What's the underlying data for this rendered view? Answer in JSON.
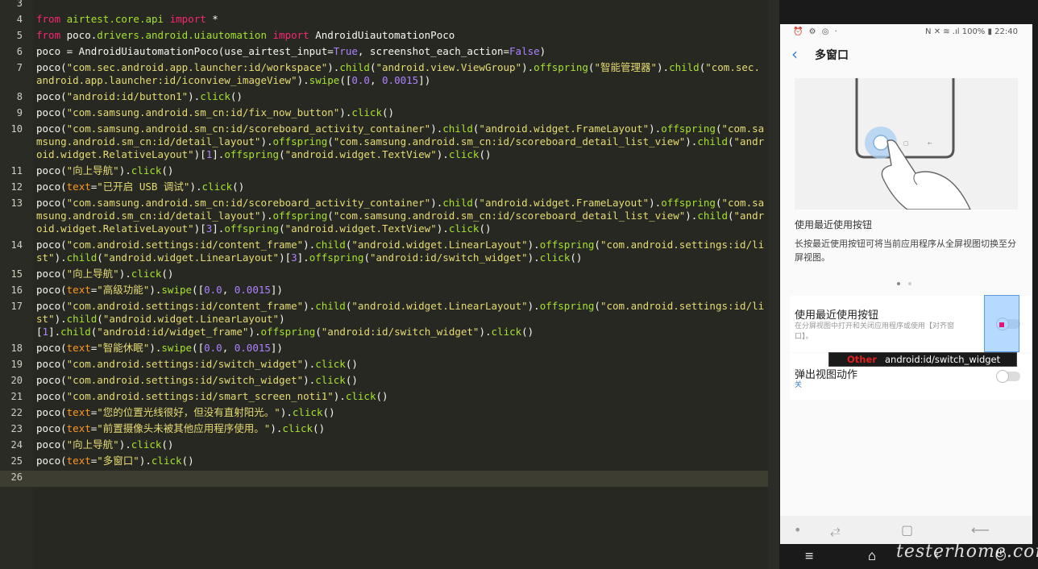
{
  "editor": {
    "lines": [
      {
        "num": "3",
        "rows": 1,
        "tokens": []
      },
      {
        "num": "4",
        "rows": 1,
        "tokens": [
          [
            "kw",
            "from"
          ],
          [
            "plain",
            " "
          ],
          [
            "mod",
            "airtest.core.api"
          ],
          [
            "plain",
            " "
          ],
          [
            "kw",
            "import"
          ],
          [
            "plain",
            " *"
          ]
        ]
      },
      {
        "num": "5",
        "rows": 1,
        "tokens": [
          [
            "kw",
            "from"
          ],
          [
            "plain",
            " poco."
          ],
          [
            "mod",
            "drivers.android.uiautomation"
          ],
          [
            "plain",
            " "
          ],
          [
            "kw",
            "import"
          ],
          [
            "plain",
            " AndroidUiautomationPoco"
          ]
        ]
      },
      {
        "num": "6",
        "rows": 1,
        "tokens": [
          [
            "plain",
            "poco = AndroidUiautomationPoco(use_airtest_input="
          ],
          [
            "const",
            "True"
          ],
          [
            "plain",
            ", screenshot_each_action="
          ],
          [
            "const",
            "False"
          ],
          [
            "plain",
            ")"
          ]
        ]
      },
      {
        "num": "7",
        "rows": 2,
        "tokens": [
          [
            "plain",
            "poco("
          ],
          [
            "str",
            "\"com.sec.android.app.launcher:id/workspace\""
          ],
          [
            "plain",
            ")."
          ],
          [
            "fn",
            "child"
          ],
          [
            "plain",
            "("
          ],
          [
            "str",
            "\"android.view.ViewGroup\""
          ],
          [
            "plain",
            ")."
          ],
          [
            "fn",
            "offspring"
          ],
          [
            "plain",
            "("
          ],
          [
            "str",
            "\"智能管理器\""
          ],
          [
            "plain",
            ")."
          ],
          [
            "fn",
            "child"
          ],
          [
            "plain",
            "("
          ],
          [
            "str",
            "\"com.sec.android.app.launcher:id/iconview_imageView\""
          ],
          [
            "plain",
            ")."
          ],
          [
            "fn",
            "swipe"
          ],
          [
            "plain",
            "(["
          ],
          [
            "num",
            "0.0"
          ],
          [
            "plain",
            ", "
          ],
          [
            "num",
            "0.0015"
          ],
          [
            "plain",
            "])"
          ]
        ]
      },
      {
        "num": "8",
        "rows": 1,
        "tokens": [
          [
            "plain",
            "poco("
          ],
          [
            "str",
            "\"android:id/button1\""
          ],
          [
            "plain",
            ")."
          ],
          [
            "fn",
            "click"
          ],
          [
            "plain",
            "()"
          ]
        ]
      },
      {
        "num": "9",
        "rows": 1,
        "tokens": [
          [
            "plain",
            "poco("
          ],
          [
            "str",
            "\"com.samsung.android.sm_cn:id/fix_now_button\""
          ],
          [
            "plain",
            ")."
          ],
          [
            "fn",
            "click"
          ],
          [
            "plain",
            "()"
          ]
        ]
      },
      {
        "num": "10",
        "rows": 3,
        "tokens": [
          [
            "plain",
            "poco("
          ],
          [
            "str",
            "\"com.samsung.android.sm_cn:id/scoreboard_activity_container\""
          ],
          [
            "plain",
            ")."
          ],
          [
            "fn",
            "child"
          ],
          [
            "plain",
            "("
          ],
          [
            "str",
            "\"android.widget.FrameLayout\""
          ],
          [
            "plain",
            ")."
          ],
          [
            "fn",
            "offspring"
          ],
          [
            "plain",
            "("
          ],
          [
            "str",
            "\"com.samsung.android.sm_cn:id/detail_layout\""
          ],
          [
            "plain",
            ")."
          ],
          [
            "fn",
            "offspring"
          ],
          [
            "plain",
            "("
          ],
          [
            "str",
            "\"com.samsung.android.sm_cn:id/scoreboard_detail_list_view\""
          ],
          [
            "plain",
            ")."
          ],
          [
            "fn",
            "child"
          ],
          [
            "plain",
            "("
          ],
          [
            "str",
            "\"android.widget.RelativeLayout\""
          ],
          [
            "plain",
            ")["
          ],
          [
            "num",
            "1"
          ],
          [
            "plain",
            "]."
          ],
          [
            "fn",
            "offspring"
          ],
          [
            "plain",
            "("
          ],
          [
            "str",
            "\"android.widget.TextView\""
          ],
          [
            "plain",
            ")."
          ],
          [
            "fn",
            "click"
          ],
          [
            "plain",
            "()"
          ]
        ]
      },
      {
        "num": "11",
        "rows": 1,
        "tokens": [
          [
            "plain",
            "poco("
          ],
          [
            "str",
            "\"向上导航\""
          ],
          [
            "plain",
            ")."
          ],
          [
            "fn",
            "click"
          ],
          [
            "plain",
            "()"
          ]
        ]
      },
      {
        "num": "12",
        "rows": 1,
        "tokens": [
          [
            "plain",
            "poco("
          ],
          [
            "param",
            "text"
          ],
          [
            "plain",
            "="
          ],
          [
            "str",
            "\"已开启 USB 调试\""
          ],
          [
            "plain",
            ")."
          ],
          [
            "fn",
            "click"
          ],
          [
            "plain",
            "()"
          ]
        ]
      },
      {
        "num": "13",
        "rows": 3,
        "tokens": [
          [
            "plain",
            "poco("
          ],
          [
            "str",
            "\"com.samsung.android.sm_cn:id/scoreboard_activity_container\""
          ],
          [
            "plain",
            ")."
          ],
          [
            "fn",
            "child"
          ],
          [
            "plain",
            "("
          ],
          [
            "str",
            "\"android.widget.FrameLayout\""
          ],
          [
            "plain",
            ")."
          ],
          [
            "fn",
            "offspring"
          ],
          [
            "plain",
            "("
          ],
          [
            "str",
            "\"com.samsung.android.sm_cn:id/detail_layout\""
          ],
          [
            "plain",
            ")."
          ],
          [
            "fn",
            "offspring"
          ],
          [
            "plain",
            "("
          ],
          [
            "str",
            "\"com.samsung.android.sm_cn:id/scoreboard_detail_list_view\""
          ],
          [
            "plain",
            ")."
          ],
          [
            "fn",
            "child"
          ],
          [
            "plain",
            "("
          ],
          [
            "str",
            "\"android.widget.RelativeLayout\""
          ],
          [
            "plain",
            ")["
          ],
          [
            "num",
            "3"
          ],
          [
            "plain",
            "]."
          ],
          [
            "fn",
            "offspring"
          ],
          [
            "plain",
            "("
          ],
          [
            "str",
            "\"android.widget.TextView\""
          ],
          [
            "plain",
            ")."
          ],
          [
            "fn",
            "click"
          ],
          [
            "plain",
            "()"
          ]
        ]
      },
      {
        "num": "14",
        "rows": 2,
        "tokens": [
          [
            "plain",
            "poco("
          ],
          [
            "str",
            "\"com.android.settings:id/content_frame\""
          ],
          [
            "plain",
            ")."
          ],
          [
            "fn",
            "child"
          ],
          [
            "plain",
            "("
          ],
          [
            "str",
            "\"android.widget.LinearLayout\""
          ],
          [
            "plain",
            ")."
          ],
          [
            "fn",
            "offspring"
          ],
          [
            "plain",
            "("
          ],
          [
            "str",
            "\"com.android.settings:id/list\""
          ],
          [
            "plain",
            ")."
          ],
          [
            "fn",
            "child"
          ],
          [
            "plain",
            "("
          ],
          [
            "str",
            "\"android.widget.LinearLayout\""
          ],
          [
            "plain",
            ")["
          ],
          [
            "num",
            "3"
          ],
          [
            "plain",
            "]."
          ],
          [
            "fn",
            "offspring"
          ],
          [
            "plain",
            "("
          ],
          [
            "str",
            "\"android:id/switch_widget\""
          ],
          [
            "plain",
            ")."
          ],
          [
            "fn",
            "click"
          ],
          [
            "plain",
            "()"
          ]
        ]
      },
      {
        "num": "15",
        "rows": 1,
        "tokens": [
          [
            "plain",
            "poco("
          ],
          [
            "str",
            "\"向上导航\""
          ],
          [
            "plain",
            ")."
          ],
          [
            "fn",
            "click"
          ],
          [
            "plain",
            "()"
          ]
        ]
      },
      {
        "num": "16",
        "rows": 1,
        "tokens": [
          [
            "plain",
            "poco("
          ],
          [
            "param",
            "text"
          ],
          [
            "plain",
            "="
          ],
          [
            "str",
            "\"高级功能\""
          ],
          [
            "plain",
            ")."
          ],
          [
            "fn",
            "swipe"
          ],
          [
            "plain",
            "(["
          ],
          [
            "num",
            "0.0"
          ],
          [
            "plain",
            ", "
          ],
          [
            "num",
            "0.0015"
          ],
          [
            "plain",
            "])"
          ]
        ]
      },
      {
        "num": "17",
        "rows": 3,
        "tokens": [
          [
            "plain",
            "poco("
          ],
          [
            "str",
            "\"com.android.settings:id/content_frame\""
          ],
          [
            "plain",
            ")."
          ],
          [
            "fn",
            "child"
          ],
          [
            "plain",
            "("
          ],
          [
            "str",
            "\"android.widget.LinearLayout\""
          ],
          [
            "plain",
            ")."
          ],
          [
            "fn",
            "offspring"
          ],
          [
            "plain",
            "("
          ],
          [
            "str",
            "\"com.android.settings:id/list\""
          ],
          [
            "plain",
            ")."
          ],
          [
            "fn",
            "child"
          ],
          [
            "plain",
            "("
          ],
          [
            "str",
            "\"android.widget.LinearLayout\""
          ],
          [
            "plain",
            ")\n["
          ],
          [
            "num",
            "1"
          ],
          [
            "plain",
            "]."
          ],
          [
            "fn",
            "child"
          ],
          [
            "plain",
            "("
          ],
          [
            "str",
            "\"android:id/widget_frame\""
          ],
          [
            "plain",
            ")."
          ],
          [
            "fn",
            "offspring"
          ],
          [
            "plain",
            "("
          ],
          [
            "str",
            "\"android:id/switch_widget\""
          ],
          [
            "plain",
            ")."
          ],
          [
            "fn",
            "click"
          ],
          [
            "plain",
            "()"
          ]
        ]
      },
      {
        "num": "18",
        "rows": 1,
        "tokens": [
          [
            "plain",
            "poco("
          ],
          [
            "param",
            "text"
          ],
          [
            "plain",
            "="
          ],
          [
            "str",
            "\"智能休眠\""
          ],
          [
            "plain",
            ")."
          ],
          [
            "fn",
            "swipe"
          ],
          [
            "plain",
            "(["
          ],
          [
            "num",
            "0.0"
          ],
          [
            "plain",
            ", "
          ],
          [
            "num",
            "0.0015"
          ],
          [
            "plain",
            "])"
          ]
        ]
      },
      {
        "num": "19",
        "rows": 1,
        "tokens": [
          [
            "plain",
            "poco("
          ],
          [
            "str",
            "\"com.android.settings:id/switch_widget\""
          ],
          [
            "plain",
            ")."
          ],
          [
            "fn",
            "click"
          ],
          [
            "plain",
            "()"
          ]
        ]
      },
      {
        "num": "20",
        "rows": 1,
        "tokens": [
          [
            "plain",
            "poco("
          ],
          [
            "str",
            "\"com.android.settings:id/switch_widget\""
          ],
          [
            "plain",
            ")."
          ],
          [
            "fn",
            "click"
          ],
          [
            "plain",
            "()"
          ]
        ]
      },
      {
        "num": "21",
        "rows": 1,
        "tokens": [
          [
            "plain",
            "poco("
          ],
          [
            "str",
            "\"com.android.settings:id/smart_screen_noti1\""
          ],
          [
            "plain",
            ")."
          ],
          [
            "fn",
            "click"
          ],
          [
            "plain",
            "()"
          ]
        ]
      },
      {
        "num": "22",
        "rows": 1,
        "tokens": [
          [
            "plain",
            "poco("
          ],
          [
            "param",
            "text"
          ],
          [
            "plain",
            "="
          ],
          [
            "str",
            "\"您的位置光线很好，但没有直射阳光。\""
          ],
          [
            "plain",
            ")."
          ],
          [
            "fn",
            "click"
          ],
          [
            "plain",
            "()"
          ]
        ]
      },
      {
        "num": "23",
        "rows": 1,
        "tokens": [
          [
            "plain",
            "poco("
          ],
          [
            "param",
            "text"
          ],
          [
            "plain",
            "="
          ],
          [
            "str",
            "\"前置摄像头未被其他应用程序使用。\""
          ],
          [
            "plain",
            ")."
          ],
          [
            "fn",
            "click"
          ],
          [
            "plain",
            "()"
          ]
        ]
      },
      {
        "num": "24",
        "rows": 1,
        "tokens": [
          [
            "plain",
            "poco("
          ],
          [
            "str",
            "\"向上导航\""
          ],
          [
            "plain",
            ")."
          ],
          [
            "fn",
            "click"
          ],
          [
            "plain",
            "()"
          ]
        ]
      },
      {
        "num": "25",
        "rows": 1,
        "tokens": [
          [
            "plain",
            "poco("
          ],
          [
            "param",
            "text"
          ],
          [
            "plain",
            "="
          ],
          [
            "str",
            "\"多窗口\""
          ],
          [
            "plain",
            ")."
          ],
          [
            "fn",
            "click"
          ],
          [
            "plain",
            "()"
          ]
        ]
      },
      {
        "num": "26",
        "rows": 1,
        "current": true,
        "tokens": []
      }
    ]
  },
  "device": {
    "status_left": "⏰ ⚙ ◎ ·",
    "status_right": "N ✕ ≋ .ıl 100% ▮ 22:40",
    "back_icon": "‹",
    "page_title": "多窗口",
    "feature_title": "使用最近使用按钮",
    "feature_desc": "长按最近使用按钮可将当前应用程序从全屏视图切换至分屏视图。",
    "settings": [
      {
        "title": "使用最近使用按钮",
        "subtitle": "在分屏视图中打开和关闭应用程序或使用【对齐窗口】。"
      },
      {
        "title": "弹出视图动作",
        "subtitle": "关"
      }
    ],
    "tooltip": {
      "type": "Other",
      "name": "android:id/switch_widget"
    },
    "phone_nav": {
      "dot": "•",
      "recent": "⥄",
      "home": "▢",
      "back": "⟵"
    },
    "host_nav": {
      "menu": "≡",
      "home": "⌂",
      "back": "‹",
      "power": "⏻"
    },
    "watermark": "testerhome.com"
  },
  "colors": {
    "editor_bg": "#272822",
    "keyword": "#f92672",
    "function": "#a6e22e",
    "string": "#e6db74",
    "number": "#ae81ff",
    "param": "#fd971f",
    "accent_blue": "#3e7ec9",
    "highlight_pink": "#e0177b"
  }
}
